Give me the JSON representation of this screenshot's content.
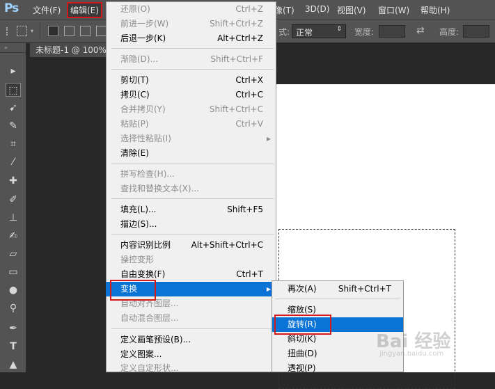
{
  "app": {
    "logo": "Ps"
  },
  "menubar": {
    "file": "文件(F)",
    "edit": "编辑(E)",
    "image_partial": "像(T)",
    "three_d": "3D(D)",
    "view": "视图(V)",
    "window": "窗口(W)",
    "help": "帮助(H)"
  },
  "options": {
    "style_label_partial": "式:",
    "style_value": "正常",
    "width_label": "宽度:",
    "height_label": "高度:",
    "swap_icon": "⇄"
  },
  "document_tab": {
    "title": "未标题-1 @ 100%"
  },
  "edit_menu": {
    "undo": {
      "label": "还原(O)",
      "shortcut": "Ctrl+Z"
    },
    "step_forward": {
      "label": "前进一步(W)",
      "shortcut": "Shift+Ctrl+Z"
    },
    "step_backward": {
      "label": "后退一步(K)",
      "shortcut": "Alt+Ctrl+Z"
    },
    "fade": {
      "label": "渐隐(D)...",
      "shortcut": "Shift+Ctrl+F"
    },
    "cut": {
      "label": "剪切(T)",
      "shortcut": "Ctrl+X"
    },
    "copy": {
      "label": "拷贝(C)",
      "shortcut": "Ctrl+C"
    },
    "copy_merged": {
      "label": "合并拷贝(Y)",
      "shortcut": "Shift+Ctrl+C"
    },
    "paste": {
      "label": "粘贴(P)",
      "shortcut": "Ctrl+V"
    },
    "paste_special": {
      "label": "选择性粘贴(I)"
    },
    "clear": {
      "label": "清除(E)"
    },
    "check_spelling": {
      "label": "拼写检查(H)..."
    },
    "find_replace": {
      "label": "查找和替换文本(X)..."
    },
    "fill": {
      "label": "填充(L)...",
      "shortcut": "Shift+F5"
    },
    "stroke": {
      "label": "描边(S)..."
    },
    "content_aware_scale": {
      "label": "内容识别比例",
      "shortcut": "Alt+Shift+Ctrl+C"
    },
    "puppet_warp": {
      "label": "操控变形"
    },
    "free_transform": {
      "label": "自由变换(F)",
      "shortcut": "Ctrl+T"
    },
    "transform": {
      "label": "变换"
    },
    "auto_align": {
      "label": "自动对齐图层..."
    },
    "auto_blend": {
      "label": "自动混合图层..."
    },
    "define_brush": {
      "label": "定义画笔预设(B)..."
    },
    "define_pattern": {
      "label": "定义图案..."
    },
    "define_shape": {
      "label": "定义自定形状..."
    }
  },
  "transform_submenu": {
    "again": {
      "label": "再次(A)",
      "shortcut": "Shift+Ctrl+T"
    },
    "scale": {
      "label": "缩放(S)"
    },
    "rotate": {
      "label": "旋转(R)"
    },
    "skew": {
      "label": "斜切(K)"
    },
    "distort": {
      "label": "扭曲(D)"
    },
    "perspective": {
      "label": "透视(P)"
    }
  },
  "watermark": {
    "text": "Bai 经验",
    "sub": "jingyan.baidu.com"
  },
  "colors": {
    "menu_bg": "#f0f0f0",
    "highlight": "#0a74d6",
    "annotation_red": "#d31a1a",
    "ui_gray": "#535353"
  }
}
